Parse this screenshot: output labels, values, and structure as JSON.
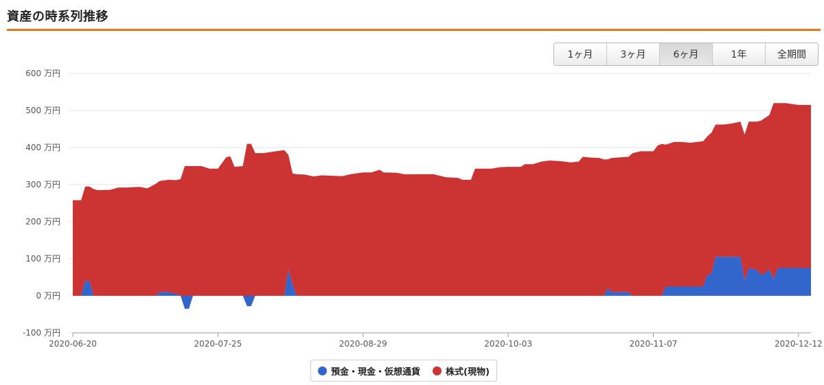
{
  "page": {
    "title": "資産の時系列推移"
  },
  "range_buttons": [
    {
      "label": "1ヶ月",
      "active": false
    },
    {
      "label": "3ヶ月",
      "active": false
    },
    {
      "label": "6ヶ月",
      "active": true
    },
    {
      "label": "1年",
      "active": false
    },
    {
      "label": "全期間",
      "active": false
    }
  ],
  "colors": {
    "accent": "#e8751a",
    "deposit": "#3366cc",
    "stock": "#cc3333"
  },
  "chart_data": {
    "type": "area",
    "stacked": true,
    "y_unit": "万円",
    "ylim": [
      -100,
      600
    ],
    "yticks": [
      -100,
      0,
      100,
      200,
      300,
      400,
      500,
      600
    ],
    "ytick_labels": [
      "-100 万円",
      "0 万円",
      "100 万円",
      "200 万円",
      "300 万円",
      "400 万円",
      "500 万円",
      "600 万円"
    ],
    "xlim": [
      "2020-06-20",
      "2020-12-15"
    ],
    "xtick_dates": [
      "2020-06-20",
      "2020-07-25",
      "2020-08-29",
      "2020-10-03",
      "2020-11-07",
      "2020-12-12"
    ],
    "grid": true,
    "legend_position": "bottom-center",
    "series": [
      {
        "name": "預金・現金・仮想通貨",
        "points": [
          [
            "2020-06-20",
            0
          ],
          [
            "2020-06-22",
            0
          ],
          [
            "2020-06-23",
            40
          ],
          [
            "2020-06-24",
            40
          ],
          [
            "2020-06-25",
            0
          ],
          [
            "2020-07-10",
            0
          ],
          [
            "2020-07-11",
            10
          ],
          [
            "2020-07-13",
            10
          ],
          [
            "2020-07-15",
            5
          ],
          [
            "2020-07-16",
            0
          ],
          [
            "2020-07-17",
            -35
          ],
          [
            "2020-07-18",
            -35
          ],
          [
            "2020-07-19",
            0
          ],
          [
            "2020-07-31",
            0
          ],
          [
            "2020-08-01",
            -28
          ],
          [
            "2020-08-02",
            -28
          ],
          [
            "2020-08-03",
            0
          ],
          [
            "2020-08-10",
            0
          ],
          [
            "2020-08-11",
            70
          ],
          [
            "2020-08-12",
            30
          ],
          [
            "2020-08-13",
            0
          ],
          [
            "2020-10-26",
            0
          ],
          [
            "2020-10-27",
            20
          ],
          [
            "2020-10-28",
            10
          ],
          [
            "2020-11-01",
            10
          ],
          [
            "2020-11-02",
            0
          ],
          [
            "2020-11-09",
            0
          ],
          [
            "2020-11-10",
            25
          ],
          [
            "2020-11-19",
            25
          ],
          [
            "2020-11-20",
            55
          ],
          [
            "2020-11-21",
            60
          ],
          [
            "2020-11-22",
            105
          ],
          [
            "2020-11-28",
            105
          ],
          [
            "2020-11-29",
            40
          ],
          [
            "2020-11-30",
            75
          ],
          [
            "2020-12-02",
            70
          ],
          [
            "2020-12-03",
            55
          ],
          [
            "2020-12-05",
            70
          ],
          [
            "2020-12-06",
            45
          ],
          [
            "2020-12-07",
            75
          ],
          [
            "2020-12-15",
            75
          ]
        ]
      },
      {
        "name": "株式(現物)",
        "points": [
          [
            "2020-06-20",
            258
          ],
          [
            "2020-06-22",
            258
          ],
          [
            "2020-06-23",
            255
          ],
          [
            "2020-06-24",
            255
          ],
          [
            "2020-06-25",
            288
          ],
          [
            "2020-06-26",
            285
          ],
          [
            "2020-06-29",
            286
          ],
          [
            "2020-07-01",
            292
          ],
          [
            "2020-07-03",
            292
          ],
          [
            "2020-07-06",
            294
          ],
          [
            "2020-07-08",
            290
          ],
          [
            "2020-07-10",
            302
          ],
          [
            "2020-07-11",
            300
          ],
          [
            "2020-07-13",
            303
          ],
          [
            "2020-07-15",
            307
          ],
          [
            "2020-07-16",
            315
          ],
          [
            "2020-07-17",
            350
          ],
          [
            "2020-07-18",
            350
          ],
          [
            "2020-07-19",
            350
          ],
          [
            "2020-07-21",
            350
          ],
          [
            "2020-07-23",
            343
          ],
          [
            "2020-07-25",
            343
          ],
          [
            "2020-07-27",
            374
          ],
          [
            "2020-07-28",
            376
          ],
          [
            "2020-07-29",
            348
          ],
          [
            "2020-07-31",
            350
          ],
          [
            "2020-08-01",
            410
          ],
          [
            "2020-08-02",
            410
          ],
          [
            "2020-08-03",
            385
          ],
          [
            "2020-08-05",
            385
          ],
          [
            "2020-08-08",
            390
          ],
          [
            "2020-08-10",
            393
          ],
          [
            "2020-08-11",
            310
          ],
          [
            "2020-08-12",
            300
          ],
          [
            "2020-08-13",
            328
          ],
          [
            "2020-08-15",
            327
          ],
          [
            "2020-08-17",
            322
          ],
          [
            "2020-08-19",
            325
          ],
          [
            "2020-08-24",
            323
          ],
          [
            "2020-08-26",
            328
          ],
          [
            "2020-08-29",
            333
          ],
          [
            "2020-08-31",
            333
          ],
          [
            "2020-09-02",
            340
          ],
          [
            "2020-09-03",
            333
          ],
          [
            "2020-09-06",
            332
          ],
          [
            "2020-09-08",
            328
          ],
          [
            "2020-09-15",
            328
          ],
          [
            "2020-09-18",
            320
          ],
          [
            "2020-09-21",
            318
          ],
          [
            "2020-09-22",
            313
          ],
          [
            "2020-09-24",
            313
          ],
          [
            "2020-09-25",
            343
          ],
          [
            "2020-09-27",
            343
          ],
          [
            "2020-09-29",
            343
          ],
          [
            "2020-10-01",
            347
          ],
          [
            "2020-10-03",
            348
          ],
          [
            "2020-10-06",
            348
          ],
          [
            "2020-10-07",
            355
          ],
          [
            "2020-10-09",
            355
          ],
          [
            "2020-10-11",
            362
          ],
          [
            "2020-10-13",
            365
          ],
          [
            "2020-10-16",
            363
          ],
          [
            "2020-10-18",
            360
          ],
          [
            "2020-10-20",
            362
          ],
          [
            "2020-10-21",
            375
          ],
          [
            "2020-10-23",
            373
          ],
          [
            "2020-10-25",
            372
          ],
          [
            "2020-10-26",
            368
          ],
          [
            "2020-10-27",
            348
          ],
          [
            "2020-10-28",
            362
          ],
          [
            "2020-11-01",
            365
          ],
          [
            "2020-11-02",
            385
          ],
          [
            "2020-11-04",
            390
          ],
          [
            "2020-11-07",
            390
          ],
          [
            "2020-11-08",
            405
          ],
          [
            "2020-11-09",
            410
          ],
          [
            "2020-11-10",
            383
          ],
          [
            "2020-11-12",
            390
          ],
          [
            "2020-11-14",
            390
          ],
          [
            "2020-11-16",
            388
          ],
          [
            "2020-11-19",
            392
          ],
          [
            "2020-11-20",
            375
          ],
          [
            "2020-11-21",
            380
          ],
          [
            "2020-11-22",
            357
          ],
          [
            "2020-11-24",
            357
          ],
          [
            "2020-11-26",
            360
          ],
          [
            "2020-11-28",
            365
          ],
          [
            "2020-11-29",
            395
          ],
          [
            "2020-11-30",
            395
          ],
          [
            "2020-12-02",
            400
          ],
          [
            "2020-12-03",
            418
          ],
          [
            "2020-12-05",
            418
          ],
          [
            "2020-12-06",
            475
          ],
          [
            "2020-12-07",
            445
          ],
          [
            "2020-12-09",
            445
          ],
          [
            "2020-12-10",
            443
          ],
          [
            "2020-12-12",
            440
          ],
          [
            "2020-12-15",
            440
          ]
        ]
      }
    ]
  }
}
